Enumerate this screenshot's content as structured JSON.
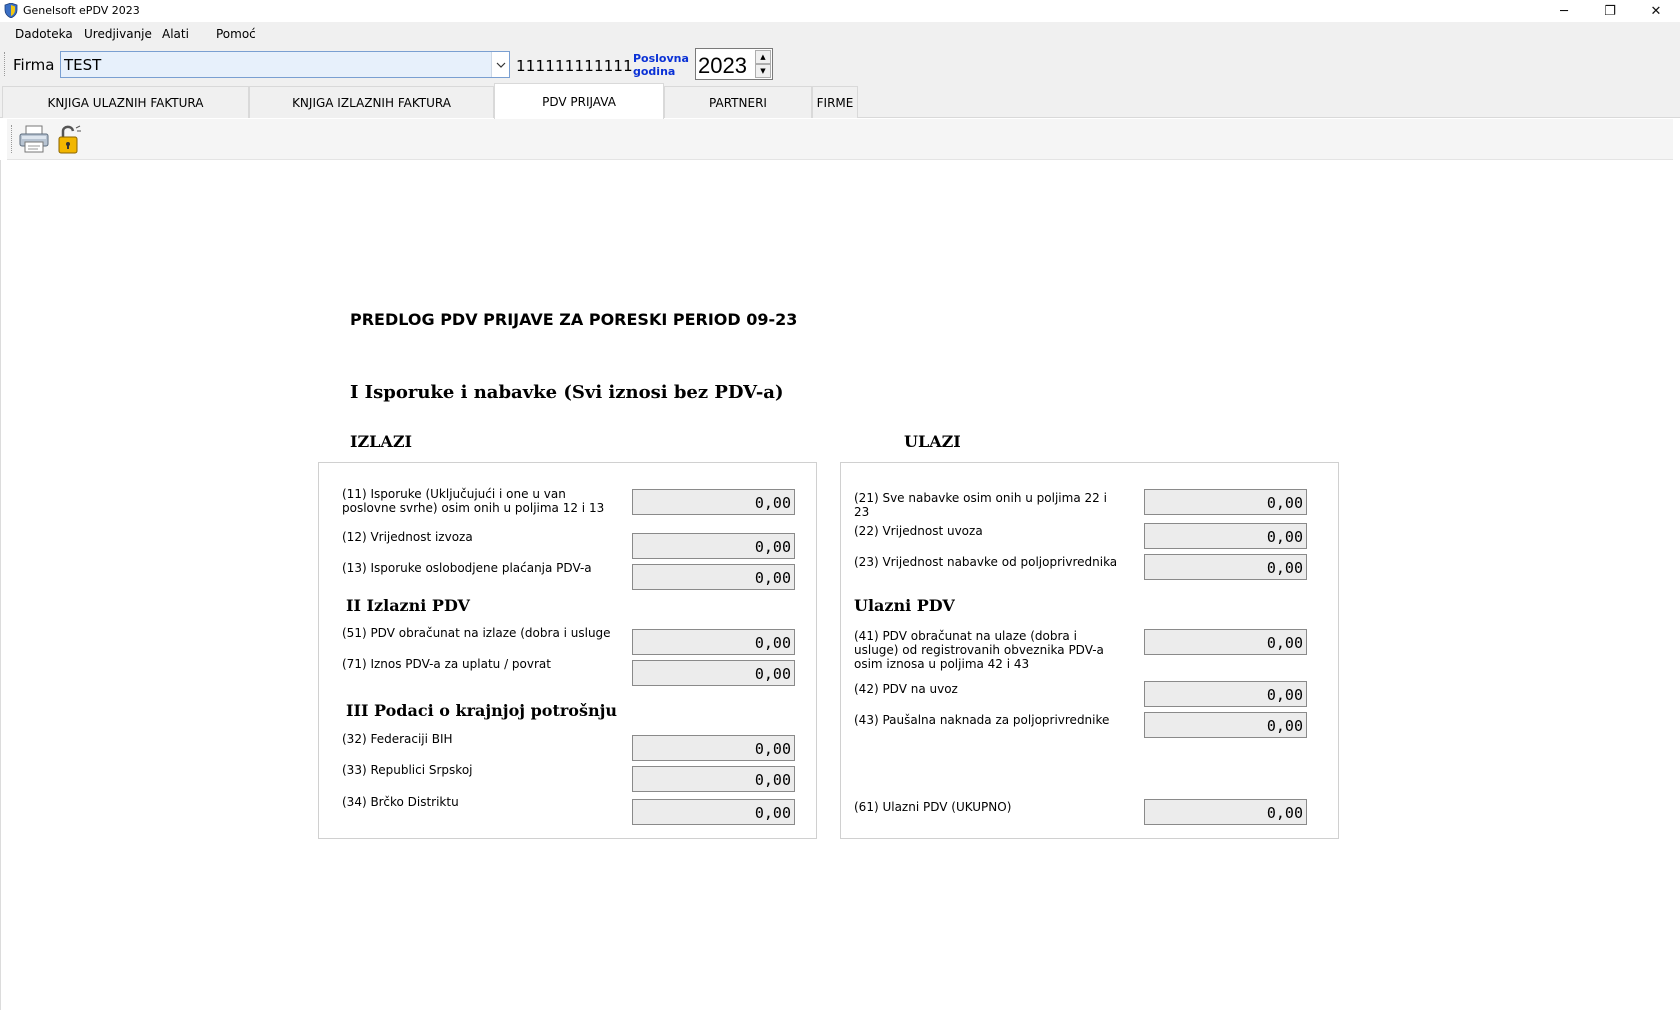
{
  "window": {
    "title": "Genelsoft ePDV 2023",
    "minimize": "─",
    "restore": "❐",
    "close": "✕"
  },
  "menu": [
    "Dadoteka",
    "Uredjivanje",
    "Alati",
    "Pomoć"
  ],
  "firm_bar": {
    "label": "Firma",
    "selected_firm": "TEST",
    "firm_id": "111111111111",
    "year_label_line1": "Poslovna",
    "year_label_line2": "godina",
    "year_value": "2023"
  },
  "tabs": [
    {
      "label": "KNJIGA ULAZNIH FAKTURA",
      "active": false
    },
    {
      "label": "KNJIGA IZLAZNIH FAKTURA",
      "active": false
    },
    {
      "label": "PDV PRIJAVA",
      "active": true
    },
    {
      "label": "PARTNERI",
      "active": false
    },
    {
      "label": "FIRME",
      "active": false
    }
  ],
  "toolbar": {
    "icons": [
      "printer-icon",
      "unlock-icon"
    ]
  },
  "report": {
    "title": "PREDLOG PDV PRIJAVE ZA PORESKI PERIOD 09-23",
    "section1": "I Isporuke i nabavke (Svi iznosi bez PDV-a)",
    "left_heading": "IZLAZI",
    "right_heading": "ULAZI",
    "left": {
      "f11_label": "(11) Isporuke (Uključujući i one u van poslovne svrhe) osim onih  u poljima 12 i 13",
      "f11_value": "0,00",
      "f12_label": "(12) Vrijednost izvoza",
      "f12_value": "0,00",
      "f13_label": "(13) Isporuke oslobodjene plaćanja PDV-a",
      "f13_value": "0,00",
      "section2": "II Izlazni PDV",
      "f51_label": "(51) PDV obračunat na izlaze (dobra i usluge",
      "f51_value": "0,00",
      "f71_label": "(71) Iznos PDV-a za uplatu / povrat",
      "f71_value": "0,00",
      "section3": "III Podaci o krajnjoj potrošnju",
      "f32_label": "(32) Federaciji BIH",
      "f32_value": "0,00",
      "f33_label": "(33) Republici Srpskoj",
      "f33_value": "0,00",
      "f34_label": "(34) Brčko Distriktu",
      "f34_value": "0,00"
    },
    "right": {
      "f21_label": "(21) Sve nabavke osim onih u poljima 22 i 23",
      "f21_value": "0,00",
      "f22_label": "(22) Vrijednost uvoza",
      "f22_value": "0,00",
      "f23_label": "(23) Vrijednost nabavke od poljoprivrednika",
      "f23_value": "0,00",
      "section": "Ulazni PDV",
      "f41_label": "(41) PDV obračunat na ulaze (dobra i usluge) od registrovanih obveznika PDV-a osim iznosa u poljima 42 i 43",
      "f41_value": "0,00",
      "f42_label": "(42) PDV na uvoz",
      "f42_value": "0,00",
      "f43_label": "(43) Paušalna naknada za poljoprivrednike",
      "f43_value": "0,00",
      "f61_label": "(61) Ulazni PDV (UKUPNO)",
      "f61_value": "0,00"
    }
  }
}
